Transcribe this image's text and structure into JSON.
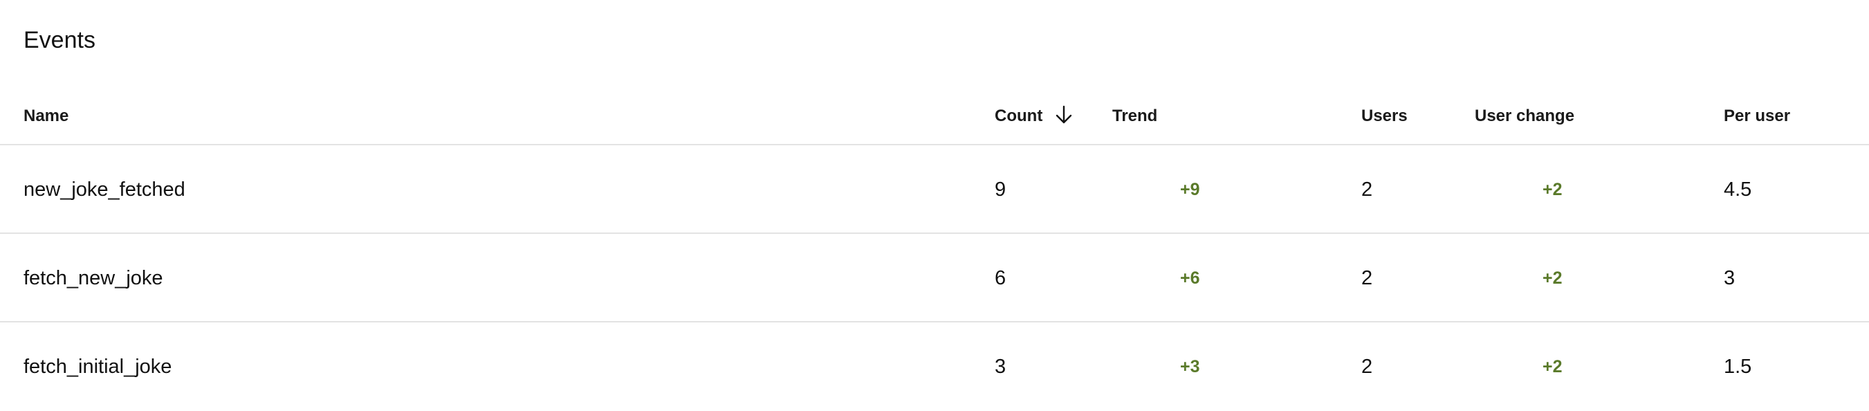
{
  "section": {
    "title": "Events"
  },
  "table": {
    "columns": {
      "name": "Name",
      "count": "Count",
      "trend": "Trend",
      "users": "Users",
      "user_change": "User change",
      "per_user": "Per user"
    },
    "sort": {
      "column": "count",
      "direction": "descending",
      "icon": "arrow-down-icon"
    },
    "rows": [
      {
        "name": "new_joke_fetched",
        "count": "9",
        "trend": "+9",
        "users": "2",
        "user_change": "+2",
        "per_user": "4.5"
      },
      {
        "name": "fetch_new_joke",
        "count": "6",
        "trend": "+6",
        "users": "2",
        "user_change": "+2",
        "per_user": "3"
      },
      {
        "name": "fetch_initial_joke",
        "count": "3",
        "trend": "+3",
        "users": "2",
        "user_change": "+2",
        "per_user": "1.5"
      }
    ]
  },
  "colors": {
    "positive_change": "#5a7a2a",
    "divider": "#e3e3e3",
    "text": "#111111"
  }
}
